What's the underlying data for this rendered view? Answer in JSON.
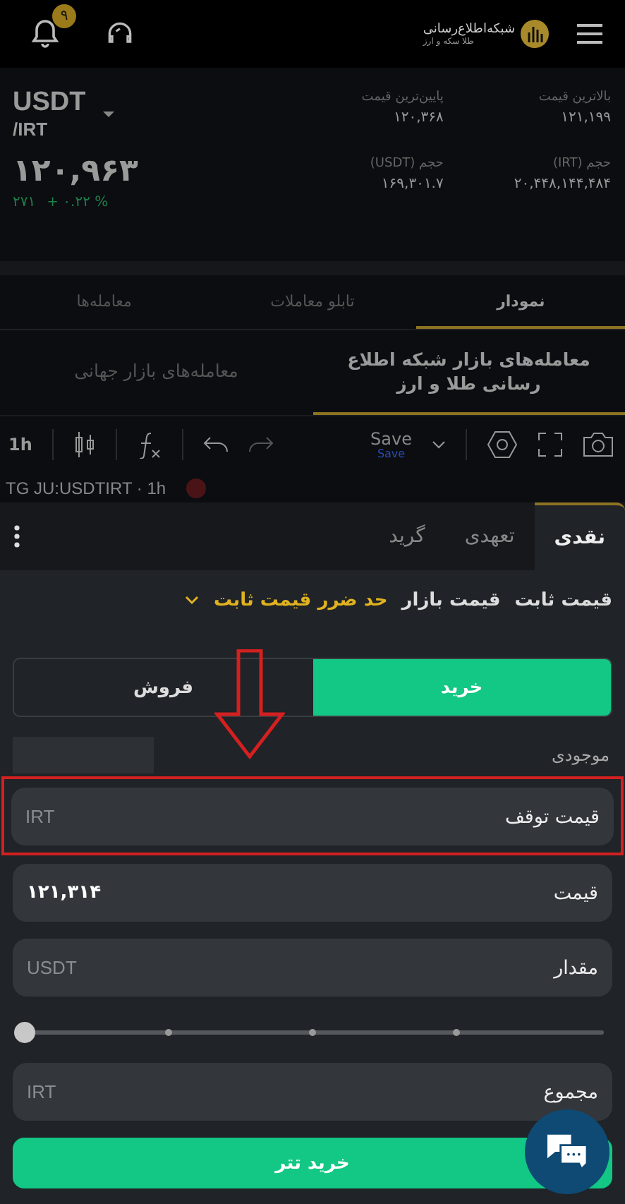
{
  "header": {
    "logo_title": "شبکه‌اطلاع‌رسانی",
    "logo_subtitle": "طلا سکه و ارز",
    "notification_count": "۹"
  },
  "market": {
    "base": "USDT",
    "quote": "/IRT",
    "last_price": "۱۲۰,۹۶۳",
    "change": "۲۷۱",
    "change_percent": "+ ۰.۲۲ %",
    "stats": [
      {
        "label": "بالاترین قیمت",
        "value": "۱۲۱,۱۹۹"
      },
      {
        "label": "پایین‌ترین قیمت",
        "value": "۱۲۰,۳۶۸"
      },
      {
        "label": "حجم (IRT)",
        "value": "۲۰,۴۴۸,۱۴۴,۴۸۴"
      },
      {
        "label": "حجم (USDT)",
        "value": "۱۶۹,۳۰۱.۷"
      }
    ]
  },
  "tabs": [
    {
      "label": "نمودار",
      "selected": true
    },
    {
      "label": "تابلو معاملات",
      "selected": false
    },
    {
      "label": "معامله‌ها",
      "selected": false
    }
  ],
  "market_tabs": [
    {
      "label": "معامله‌های بازار شبکه اطلاع رسانی طلا و ارز",
      "selected": true
    },
    {
      "label": "معامله‌های بازار جهانی",
      "selected": false
    }
  ],
  "chart_toolbar": {
    "interval": "1h",
    "save_label": "Save",
    "save_sublabel": "Save"
  },
  "chart_title": "TG JU:USDTIRT · 1h",
  "order_panel": {
    "tabs": [
      {
        "label": "نقدی",
        "selected": true
      },
      {
        "label": "تعهدی",
        "selected": false
      },
      {
        "label": "گرید",
        "selected": false
      }
    ],
    "order_types": [
      {
        "label": "قیمت ثابت",
        "selected": false
      },
      {
        "label": "قیمت بازار",
        "selected": false
      },
      {
        "label": "حد ضرر قیمت ثابت",
        "selected": true
      }
    ],
    "sides": [
      {
        "label": "خرید",
        "selected": true
      },
      {
        "label": "فروش",
        "selected": false
      }
    ],
    "balance_label": "موجودی",
    "fields": [
      {
        "label": "قیمت توقف",
        "placeholder": "IRT"
      },
      {
        "label": "قیمت",
        "value": "۱۲۱,۳۱۴"
      },
      {
        "label": "مقدار",
        "placeholder": "USDT"
      }
    ],
    "slider": {
      "level": 0
    },
    "total": {
      "label": "مجموع",
      "placeholder": "IRT"
    },
    "submit": "خرید تتر"
  }
}
